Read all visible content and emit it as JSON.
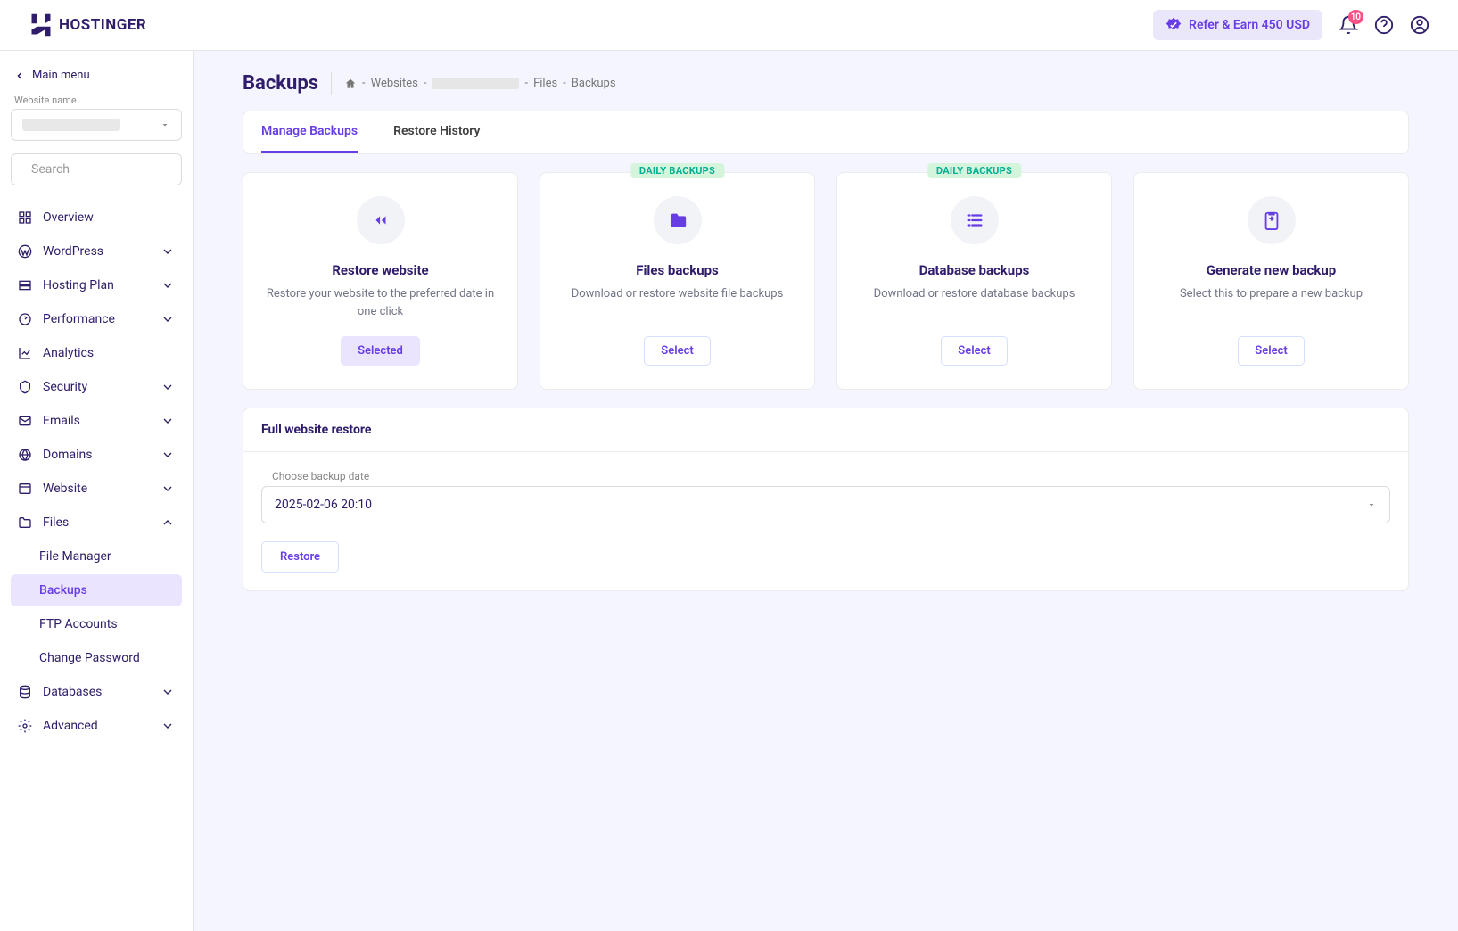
{
  "header": {
    "logo_text": "HOSTINGER",
    "refer_label": "Refer & Earn 450 USD",
    "notification_count": "10"
  },
  "sidebar": {
    "main_menu": "Main menu",
    "website_label": "Website name",
    "search_placeholder": "Search",
    "items": {
      "overview": "Overview",
      "wordpress": "WordPress",
      "hosting_plan": "Hosting Plan",
      "performance": "Performance",
      "analytics": "Analytics",
      "security": "Security",
      "emails": "Emails",
      "domains": "Domains",
      "website": "Website",
      "files": "Files",
      "databases": "Databases",
      "advanced": "Advanced"
    },
    "files_sub": {
      "file_manager": "File Manager",
      "backups": "Backups",
      "ftp": "FTP Accounts",
      "change_pw": "Change Password"
    }
  },
  "page": {
    "title": "Backups",
    "crumbs": {
      "websites": "Websites",
      "files": "Files",
      "backups": "Backups"
    },
    "tabs": {
      "manage": "Manage Backups",
      "history": "Restore History"
    },
    "cards": [
      {
        "tag": "",
        "title": "Restore website",
        "desc": "Restore your website to the preferred date in one click",
        "btn": "Selected",
        "selected": true
      },
      {
        "tag": "DAILY BACKUPS",
        "title": "Files backups",
        "desc": "Download or restore website file backups",
        "btn": "Select",
        "selected": false
      },
      {
        "tag": "DAILY BACKUPS",
        "title": "Database backups",
        "desc": "Download or restore database backups",
        "btn": "Select",
        "selected": false
      },
      {
        "tag": "",
        "title": "Generate new backup",
        "desc": "Select this to prepare a new backup",
        "btn": "Select",
        "selected": false
      }
    ],
    "panel": {
      "title": "Full website restore",
      "date_label": "Choose backup date",
      "date_value": "2025-02-06 20:10",
      "restore_btn": "Restore"
    }
  }
}
